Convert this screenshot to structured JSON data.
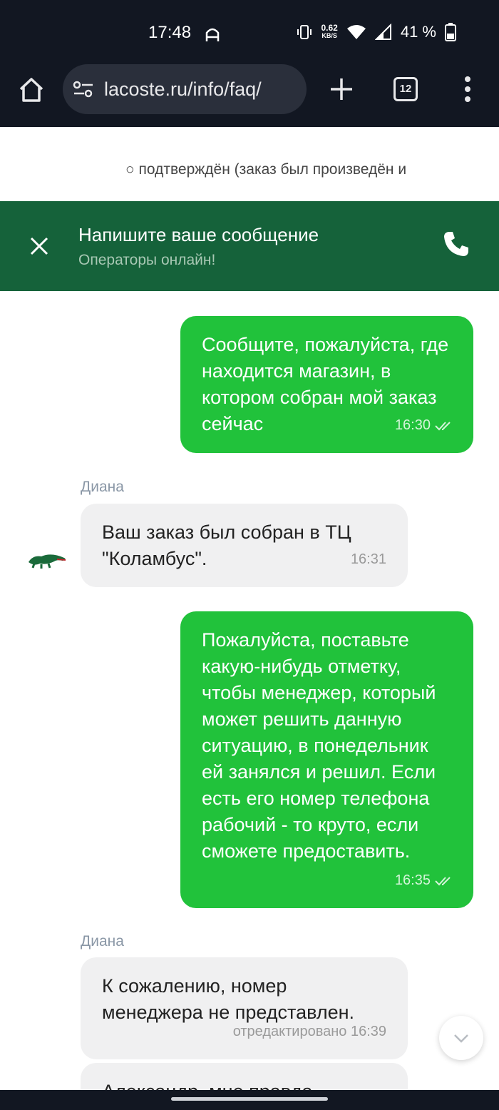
{
  "status_bar": {
    "time": "17:48",
    "net_speed_value": "0.62",
    "net_speed_unit": "KB/S",
    "battery": "41 %"
  },
  "browser": {
    "url": "lacoste.ru/info/faq/",
    "tab_count": "12"
  },
  "page_behind": {
    "text": "○  подтверждён (заказ был произведён и"
  },
  "chat": {
    "title": "Напишите ваше сообщение",
    "subtitle": "Операторы онлайн!",
    "messages": [
      {
        "direction": "out",
        "text": "Сообщите, пожалуйста, где находится магазин, в котором собран мой заказ сейчас",
        "time": "16:30"
      },
      {
        "direction": "in",
        "sender": "Диана",
        "text": "Ваш заказ был собран в ТЦ \"Коламбус\".",
        "time": "16:31"
      },
      {
        "direction": "out",
        "text": "Пожалуйста, поставьте какую-нибудь отметку, чтобы менеджер, который может решить данную ситуацию, в понедельник ей занялся и решил. Если есть его номер телефона рабочий - то круто, если сможете предоставить.",
        "time": "16:35"
      },
      {
        "direction": "in",
        "sender": "Диана",
        "text": "К сожалению, номер менеджера не представлен.",
        "time": "отредактировано 16:39"
      },
      {
        "direction": "in",
        "text": "Александр, мне правда"
      }
    ]
  },
  "icons": {
    "home": "home-icon",
    "site_settings": "tune-icon",
    "new_tab": "plus-icon",
    "menu": "more-vert-icon",
    "close": "close-icon",
    "call": "phone-icon",
    "read_receipt": "double-check-icon",
    "scroll_down": "chevron-down-icon"
  },
  "colors": {
    "header_green": "#15623a",
    "outgoing_bubble": "#21c23b",
    "incoming_bubble": "#f0f0f1",
    "browser_chrome": "#121722"
  }
}
